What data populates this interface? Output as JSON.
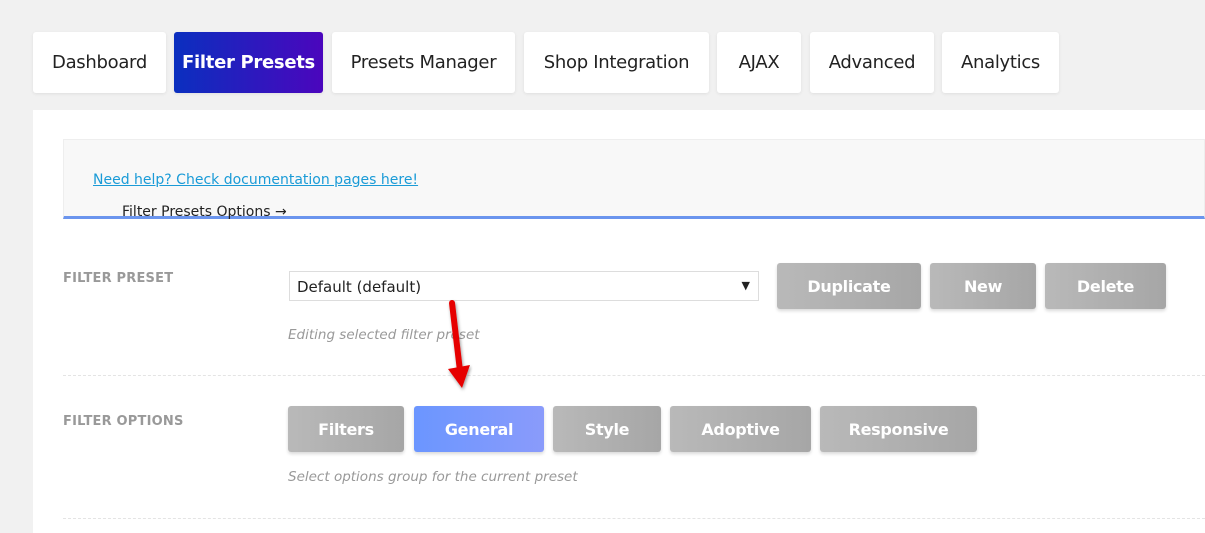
{
  "tabs": [
    {
      "label": "Dashboard"
    },
    {
      "label": "Filter Presets",
      "active": true
    },
    {
      "label": "Presets Manager"
    },
    {
      "label": "Shop Integration"
    },
    {
      "label": "AJAX"
    },
    {
      "label": "Advanced"
    },
    {
      "label": "Analytics"
    }
  ],
  "notice": {
    "text": "Filter Presets Options →",
    "link": "Need help? Check documentation pages here!"
  },
  "filter_preset": {
    "label": "FILTER PRESET",
    "selected": "Default (default)",
    "help": "Editing selected filter preset",
    "buttons": [
      "Duplicate",
      "New",
      "Delete"
    ]
  },
  "filter_options": {
    "label": "FILTER OPTIONS",
    "buttons": [
      "Filters",
      "General",
      "Style",
      "Adoptive",
      "Responsive"
    ],
    "selected": "General",
    "help": "Select options group for the current preset"
  },
  "colors": {
    "active_tab_start": "#0a2fbf",
    "active_tab_end": "#4b06bd",
    "selected_option": "#6b96ff",
    "annotation_arrow": "#e60000"
  }
}
